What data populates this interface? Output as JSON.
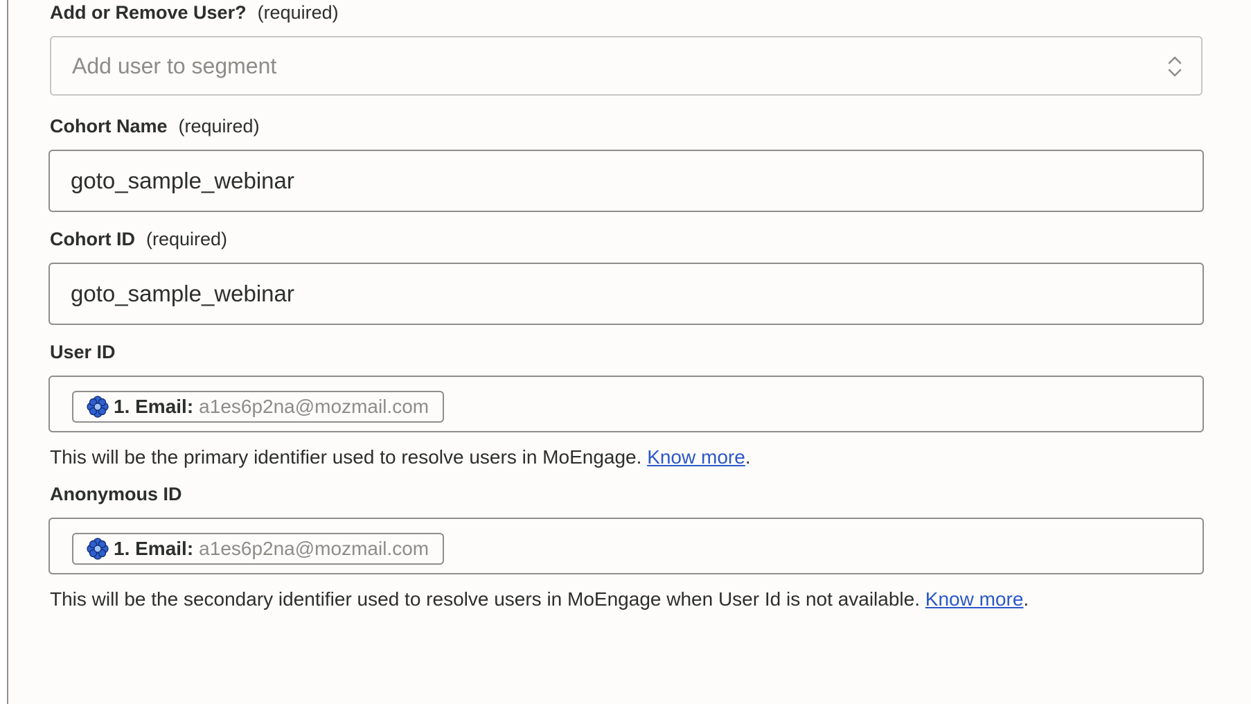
{
  "form": {
    "action_field": {
      "label": "Add or Remove User?",
      "required": "(required)",
      "placeholder": "Add user to segment"
    },
    "cohort_name": {
      "label": "Cohort Name",
      "required": "(required)",
      "value": "goto_sample_webinar"
    },
    "cohort_id": {
      "label": "Cohort ID",
      "required": "(required)",
      "value": "goto_sample_webinar"
    },
    "user_id": {
      "label": "User ID",
      "pill": {
        "icon": "gotowebinar-flower-icon",
        "step": "1. Email:",
        "value": "a1es6p2na@mozmail.com"
      },
      "help_text": "This will be the primary identifier used to resolve users in MoEngage. ",
      "help_link": "Know more",
      "help_suffix": "."
    },
    "anonymous_id": {
      "label": "Anonymous ID",
      "pill": {
        "icon": "gotowebinar-flower-icon",
        "step": "1. Email:",
        "value": "a1es6p2na@mozmail.com"
      },
      "help_text": "This will be the secondary identifier used to resolve users in MoEngage when User Id is not available. ",
      "help_link": "Know more",
      "help_suffix": "."
    }
  },
  "colors": {
    "background": "#fdfcfa",
    "text": "#2d2e2e",
    "muted_text": "#8e8c87",
    "link": "#2b57c9",
    "border": "#8f8e8a",
    "icon_blue": "#2f5fd0"
  }
}
